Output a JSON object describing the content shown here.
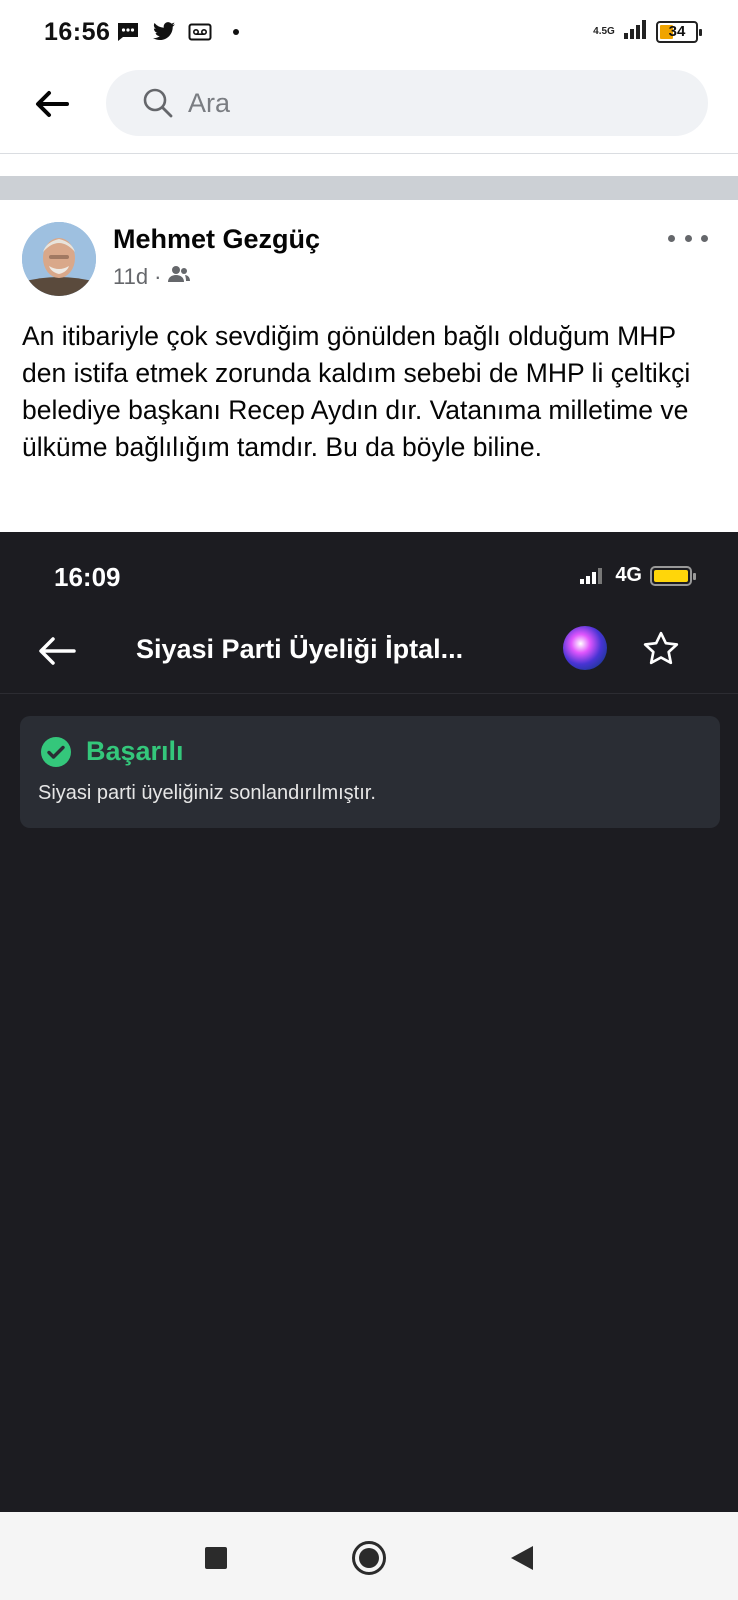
{
  "status_bar": {
    "time": "16:56",
    "network": "4.5G",
    "battery": "34",
    "icons": [
      "message-icon",
      "twitter-icon",
      "voicemail-icon",
      "dot-icon"
    ]
  },
  "search": {
    "placeholder": "Ara"
  },
  "post": {
    "author": "Mehmet Gezgüç",
    "time": "11d",
    "audience_icon": "friends-icon",
    "text": "An itibariyle çok sevdiğim gönülden bağlı olduğum MHP den istifa etmek zorunda kaldım sebebi de MHP li çeltikçi belediye başkanı Recep Aydın dır. Vatanıma milletime ve ülküme bağlılığım tamdır. Bu da böyle biline."
  },
  "embedded_screenshot": {
    "time": "16:09",
    "network": "4G",
    "title": "Siyasi Parti Üyeliği İptal...",
    "alert": {
      "title": "Başarılı",
      "message": "Siyasi parti üyeliğiniz sonlandırılmıştır."
    }
  },
  "colors": {
    "success": "#34c77b",
    "dark_bg": "#1c1c21",
    "card_bg": "#2a2d34"
  }
}
